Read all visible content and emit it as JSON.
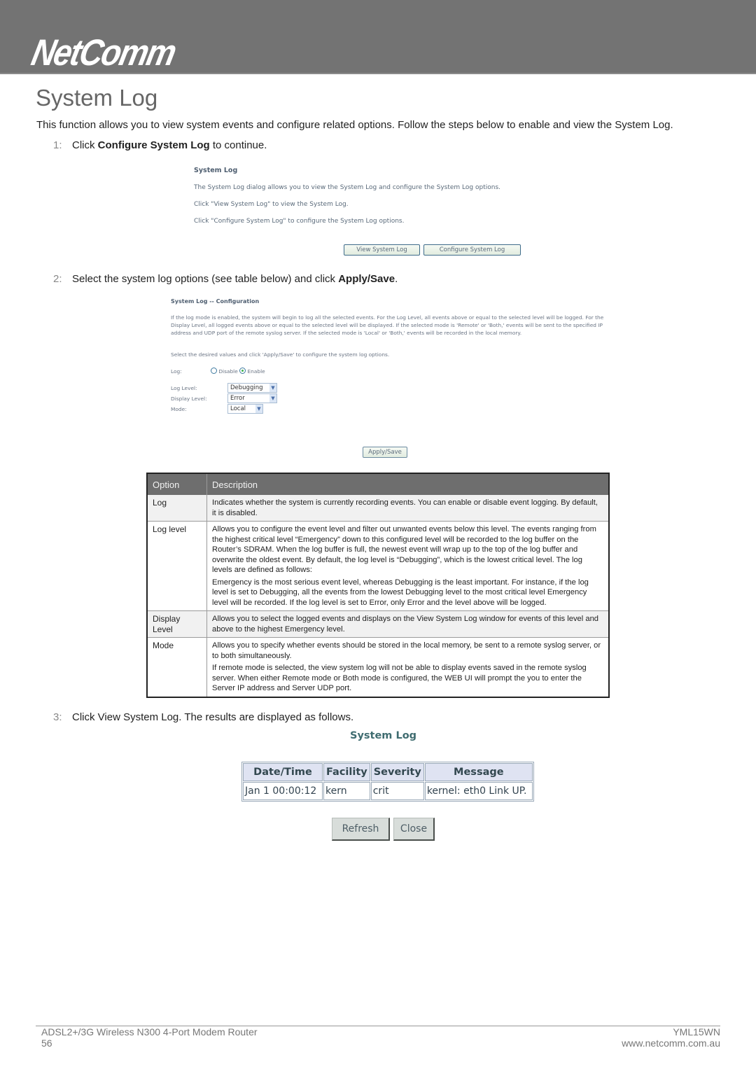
{
  "header": {
    "brand": "NetComm"
  },
  "page": {
    "title": "System Log",
    "intro": "This function allows you to view system events and configure related options. Follow the steps below to enable and view the System Log."
  },
  "steps": [
    {
      "num": "1:",
      "pre": "Click ",
      "bold": "Configure System Log",
      "post": " to continue."
    },
    {
      "num": "2:",
      "pre": "Select the system log options (see table below) and click ",
      "bold": "Apply/Save",
      "post": "."
    },
    {
      "num": "3:",
      "pre": "Click View System Log. The results are displayed as follows.",
      "bold": "",
      "post": ""
    }
  ],
  "screenshot1": {
    "title": "System Log",
    "lines": [
      "The System Log dialog allows you to view the System Log and configure the System Log options.",
      "Click \"View System Log\" to view the System Log.",
      "Click \"Configure System Log\" to configure the System Log options."
    ],
    "buttons": {
      "view": "View System Log",
      "configure": "Configure System Log"
    }
  },
  "screenshot2": {
    "title": "System Log -- Configuration",
    "paragraph": "If the log mode is enabled, the system will begin to log all the selected events. For the Log Level, all events above or equal to the selected level will be logged. For the Display Level, all logged events above or equal to the selected level will be displayed. If the selected mode is 'Remote' or 'Both,' events will be sent to the specified IP address and UDP port of the remote syslog server. If the selected mode is 'Local' or 'Both,' events will be recorded in the local memory.",
    "select_note": "Select the desired values and click 'Apply/Save' to configure the system log options.",
    "log_label": "Log:",
    "radio_disable": "Disable",
    "radio_enable": "Enable",
    "log_enabled": true,
    "log_level_label": "Log Level:",
    "log_level_value": "Debugging",
    "display_level_label": "Display Level:",
    "display_level_value": "Error",
    "mode_label": "Mode:",
    "mode_value": "Local",
    "apply_button": "Apply/Save"
  },
  "options_table": {
    "headers": [
      "Option",
      "Description"
    ],
    "rows": [
      {
        "option": "Log",
        "desc": [
          "Indicates whether the system is currently recording events.  You can enable or disable event logging. By default, it is disabled."
        ]
      },
      {
        "option": "Log level",
        "desc": [
          "Allows you to configure the event level and filter out unwanted events below this level.  The events ranging from the highest critical level “Emergency” down to this configured level will be recorded to the log buffer on the Router’s SDRAM.  When the log buffer is full, the newest event will wrap up to the top of the log buffer and overwrite the oldest event.  By default, the log level is “Debugging”, which is the lowest critical level.  The log levels are defined as follows:",
          "Emergency is the most serious event level, whereas Debugging is the least important.  For instance, if the log level is set to Debugging, all the events from the lowest Debugging level to the most critical level Emergency level will be recorded.  If the log level is set to Error, only Error and the level above will be logged."
        ]
      },
      {
        "option": "Display Level",
        "desc": [
          "Allows you to select the logged events and displays on the View System Log window for events of this level and above to the highest Emergency level."
        ]
      },
      {
        "option": "Mode",
        "desc": [
          "Allows you to specify whether events should be stored in the local memory, be sent to a remote syslog server, or to both simultaneously.",
          "If remote mode is selected, the view system log will not be able to display events saved in the remote syslog server.  When either Remote mode or Both mode is configured, the WEB UI will prompt the you to enter the Server IP address and Server UDP port."
        ]
      }
    ]
  },
  "screenshot3": {
    "title": "System Log",
    "headers": [
      "Date/Time",
      "Facility",
      "Severity",
      "Message"
    ],
    "rows": [
      [
        "Jan 1 00:00:12",
        "kern",
        "crit",
        "kernel: eth0 Link UP."
      ]
    ],
    "buttons": {
      "refresh": "Refresh",
      "close": "Close"
    }
  },
  "footer": {
    "product": "ADSL2+/3G Wireless N300 4-Port Modem Router",
    "page_number": "56",
    "model": "YML15WN",
    "website": "www.netcomm.com.au"
  }
}
